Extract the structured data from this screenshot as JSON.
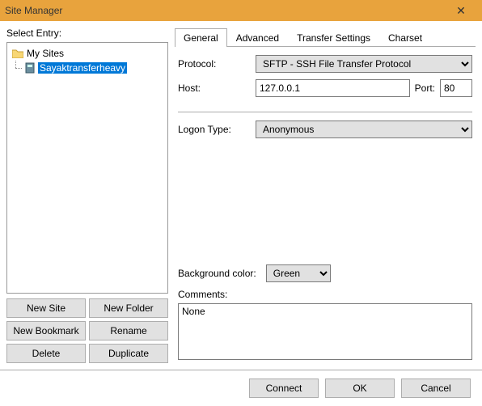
{
  "window": {
    "title": "Site Manager"
  },
  "left": {
    "label": "Select Entry:",
    "root": "My Sites",
    "selected": "Sayaktransferheavy",
    "buttons": {
      "new_site": "New Site",
      "new_folder": "New Folder",
      "new_bookmark": "New Bookmark",
      "rename": "Rename",
      "delete": "Delete",
      "duplicate": "Duplicate"
    }
  },
  "tabs": {
    "general": "General",
    "advanced": "Advanced",
    "transfer": "Transfer Settings",
    "charset": "Charset"
  },
  "general": {
    "protocol_label": "Protocol:",
    "protocol_value": "SFTP - SSH File Transfer Protocol",
    "host_label": "Host:",
    "host_value": "127.0.0.1",
    "port_label": "Port:",
    "port_value": "80",
    "logon_label": "Logon Type:",
    "logon_value": "Anonymous",
    "bgcolor_label": "Background color:",
    "bgcolor_value": "Green",
    "comments_label": "Comments:",
    "comments_value": "None"
  },
  "dialog": {
    "connect": "Connect",
    "ok": "OK",
    "cancel": "Cancel"
  }
}
